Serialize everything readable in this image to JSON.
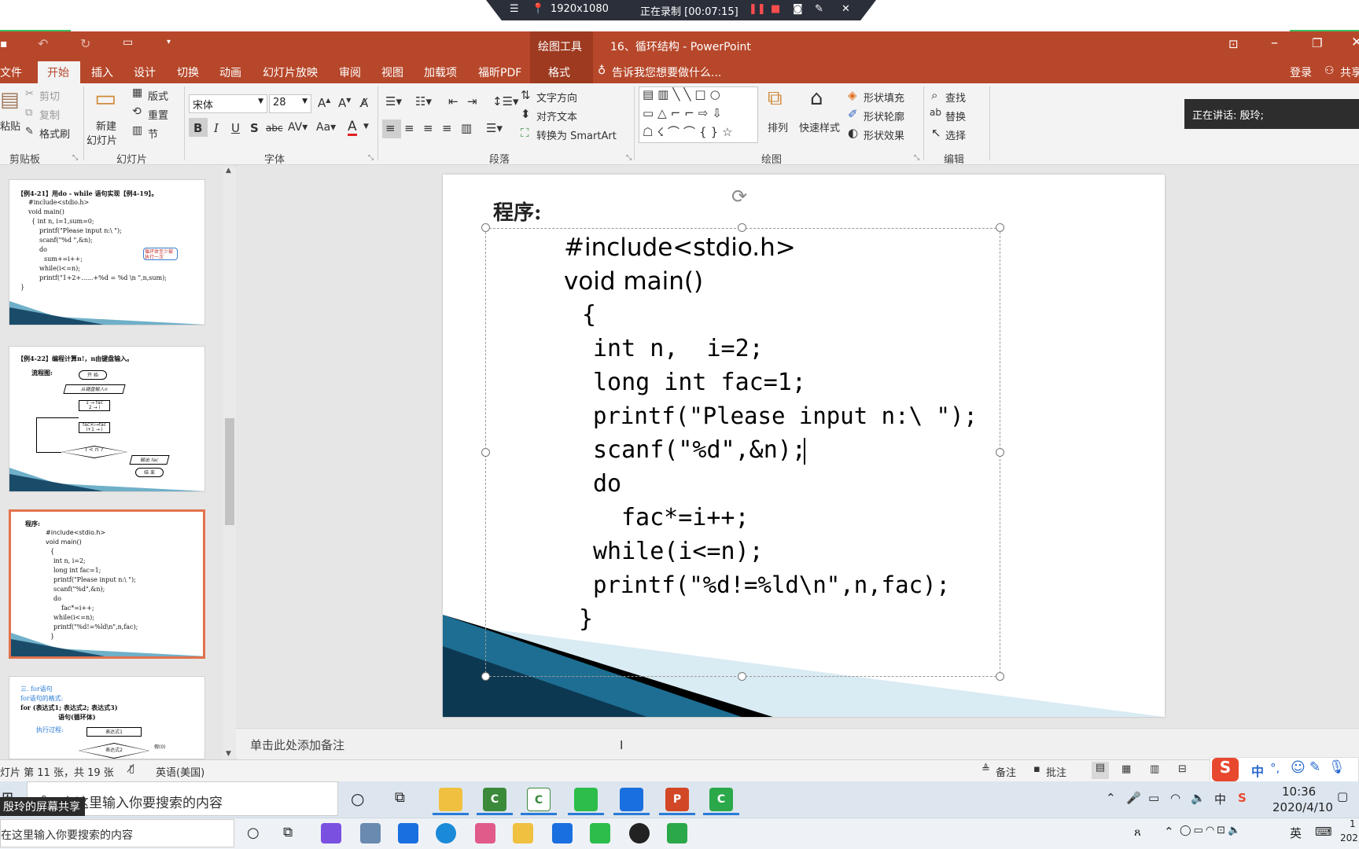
{
  "recording": {
    "resolution": "1920x1080",
    "status": "正在录制 [00:07:15]"
  },
  "window": {
    "context_tab": "绘图工具",
    "title": "16、循环结构 - PowerPoint",
    "login": "登录",
    "share": "共享"
  },
  "ribbon_tabs": [
    "文件",
    "开始",
    "插入",
    "设计",
    "切换",
    "动画",
    "幻灯片放映",
    "审阅",
    "视图",
    "加载项",
    "福昕PDF",
    "格式"
  ],
  "tell_me": "告诉我您想要做什么...",
  "clipboard": {
    "paste": "粘贴",
    "cut": "剪切",
    "copy": "复制",
    "format_painter": "格式刷",
    "group": "剪贴板"
  },
  "slides_group": {
    "new_slide_1": "新建",
    "new_slide_2": "幻灯片",
    "layout": "版式",
    "reset": "重置",
    "section": "节",
    "group": "幻灯片"
  },
  "font": {
    "name": "宋体",
    "size": "28",
    "group": "字体"
  },
  "paragraph": {
    "text_direction": "文字方向",
    "align_text": "对齐文本",
    "smartart": "转换为 SmartArt",
    "group": "段落"
  },
  "drawing": {
    "arrange": "排列",
    "quick_styles": "快速样式",
    "shape_fill": "形状填充",
    "shape_outline": "形状轮廓",
    "shape_effects": "形状效果",
    "group": "绘图"
  },
  "editing": {
    "find": "查找",
    "replace": "替换",
    "select": "选择",
    "group": "编辑"
  },
  "speaking_notice": "正在讲话: 殷玲;",
  "thumbnails": [
    {
      "lines": [
        "【例4-21】用do - while 语句实现【例4-19】。",
        "#include<stdio.h>",
        "void main()",
        "{ int n, i=1,sum=0;",
        "printf(\"Please input n:\\ \");",
        "scanf(\"%d \",&n);",
        "do",
        "sum+=i++;",
        "while(i<=n);",
        "printf(\"1+2+......+%d = %d \\n \",n,sum);",
        "}"
      ],
      "callout": "循环体至少被执行一次"
    },
    {
      "lines": [
        "【例4-22】编程计算n!，n由键盘输入。",
        "流程图:"
      ],
      "flow": [
        "开 始",
        "从键盘输入n",
        "1 → fac",
        "2 → i",
        "fac×i→fac",
        "i+1 → i",
        "i < n ?",
        "输出 fac",
        "结 束"
      ]
    },
    {
      "lines": [
        "程序:",
        "#include<stdio.h>",
        "void main()",
        "{",
        "int n,  i=2;",
        "long int fac=1;",
        "printf(\"Please input n:\\ \");",
        "scanf(\"%d\",&n);",
        "do",
        "fac*=i++;",
        "while(i<=n);",
        "printf(\"%d!=%ld\\n\",n,fac);",
        "}"
      ]
    },
    {
      "lines": [
        "三. for语句",
        "for语句的格式:",
        "for (表达式1; 表达式2; 表达式3)",
        "语句(循环体)",
        "执行过程:"
      ],
      "flow": [
        "表达式1",
        "表达式2",
        "假(0)"
      ]
    }
  ],
  "slide": {
    "heading": "程序:",
    "code": [
      "#include<stdio.h>",
      "void main()",
      "{",
      "int n,  i=2;",
      "long int fac=1;",
      "printf(\"Please input n:\\ \");",
      "scanf(\"%d\",&n);",
      "do",
      "fac*=i++;",
      "while(i<=n);",
      "printf(\"%d!=%ld\\n\",n,fac);",
      "}"
    ]
  },
  "notes_placeholder": "单击此处添加备注",
  "status": {
    "slide_info": "灯片 第 11 张，共 19 张",
    "language": "英语(美国)",
    "notes": "备注",
    "comments": "批注"
  },
  "taskbar": {
    "search_placeholder": "在这里输入你要搜索的内容",
    "time": "10:36",
    "date": "2020/4/10",
    "ime_zh": "中",
    "ime_en": "英",
    "share_label": "殷玲的屏幕共享",
    "search2": "在这里输入你要搜索的内容",
    "clock2_1": "1",
    "clock2_2": "202"
  },
  "colors": {
    "accent": "#b7472a",
    "selected_thumb": "#e2724c",
    "taskbar": "#dde6ef"
  }
}
